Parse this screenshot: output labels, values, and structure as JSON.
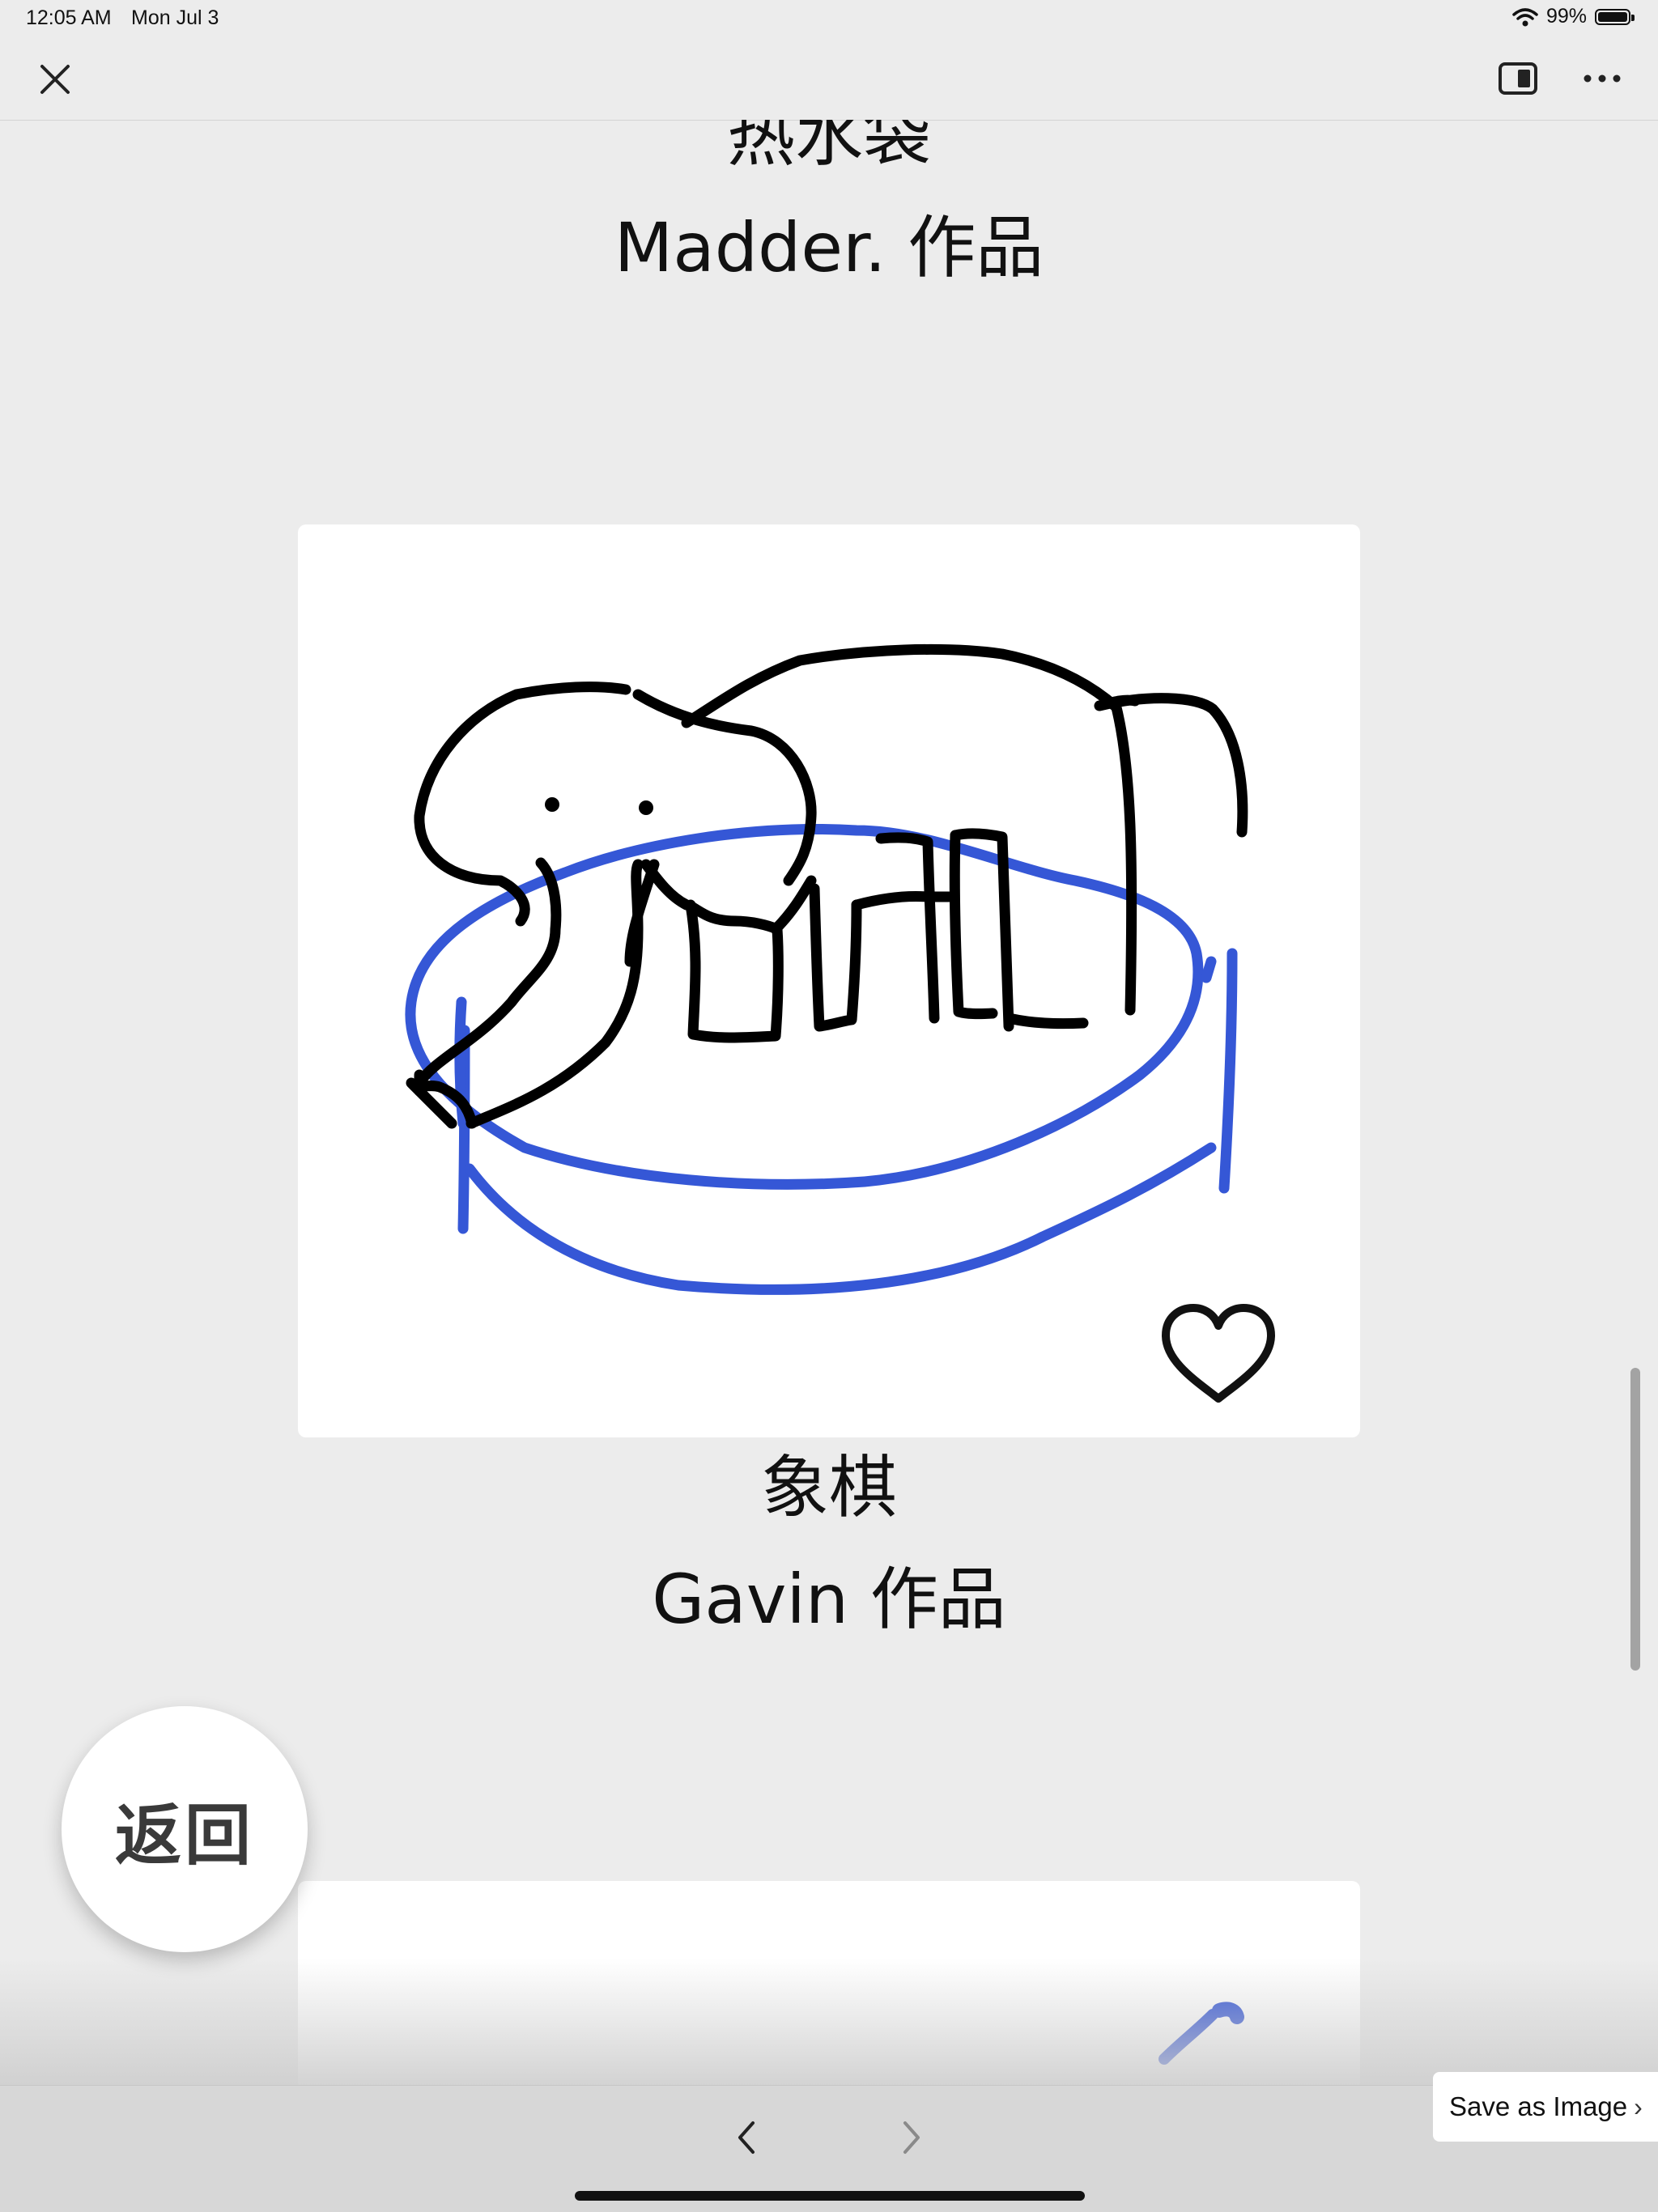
{
  "status_bar": {
    "time": "12:05 AM",
    "date": "Mon Jul 3",
    "battery_text": "99%",
    "battery_level": 0.99
  },
  "toolbar": {
    "close_icon": "close-icon",
    "reader_icon": "sidebar-toggle-icon",
    "more_icon": "more-icon"
  },
  "feed": {
    "items": [
      {
        "title": "热水袋",
        "author": "Madder. 作品"
      },
      {
        "title": "象棋",
        "author": "Gavin 作品"
      }
    ]
  },
  "back_button": {
    "label": "返回"
  },
  "save_image": {
    "label": "Save as Image",
    "icon": "chevron-right-icon"
  },
  "bottom_nav": {
    "back_icon": "chevron-left-icon",
    "forward_icon": "chevron-right-icon"
  },
  "colors": {
    "ink": "#000000",
    "drawing_blue": "#3557d6",
    "page_bg": "#ececec"
  }
}
